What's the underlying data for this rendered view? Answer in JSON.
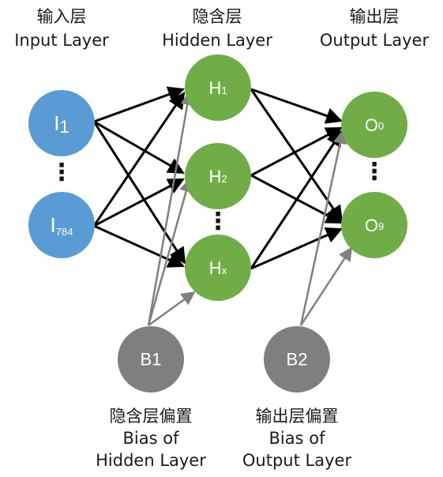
{
  "headers": {
    "input": {
      "zh": "输入层",
      "en": "Input Layer"
    },
    "hidden": {
      "zh": "隐含层",
      "en": "Hidden Layer"
    },
    "output": {
      "zh": "输出层",
      "en": "Output Layer"
    }
  },
  "nodes": {
    "i1": {
      "main": "I",
      "sub": "1"
    },
    "i784": {
      "main": "I",
      "sub": "784"
    },
    "h1": {
      "main": "H",
      "sub": "1"
    },
    "h2": {
      "main": "H",
      "sub": "2"
    },
    "hx": {
      "main": "H",
      "sub": "x"
    },
    "o0": {
      "main": "O",
      "sub": "0"
    },
    "o9": {
      "main": "O",
      "sub": "9"
    },
    "b1": {
      "label": "B1"
    },
    "b2": {
      "label": "B2"
    }
  },
  "bias_captions": {
    "hidden": {
      "zh": "隐含层偏置",
      "line2": "Bias of",
      "line3": "Hidden Layer"
    },
    "output": {
      "zh": "输出层偏置",
      "line2": "Bias of",
      "line3": "Output Layer"
    }
  },
  "ellipsis": "⋮",
  "colors": {
    "input_node": "#5b9bd5",
    "hidden_node": "#70ad47",
    "output_node": "#70ad47",
    "bias_node": "#7f7f7f",
    "weight_edge": "#000000",
    "bias_edge": "#808080"
  }
}
